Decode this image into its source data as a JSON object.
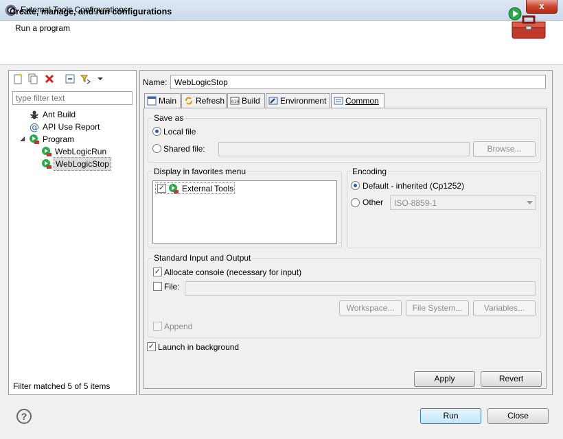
{
  "window": {
    "title": "External Tools Configurations",
    "close_glyph": "x"
  },
  "banner": {
    "title": "Create, manage, and run configurations",
    "subtitle": "Run a program",
    "icon": "toolbox-run-icon"
  },
  "left": {
    "toolbar": [
      "new-config-icon",
      "duplicate-icon",
      "delete-icon",
      "collapse-all-icon",
      "filter-icon",
      "dropdown-arrow-icon"
    ],
    "filter_placeholder": "type filter text",
    "tree": [
      {
        "label": "Ant Build",
        "icon": "ant-icon",
        "level": 1
      },
      {
        "label": "API Use Report",
        "icon": "at-icon",
        "level": 1
      },
      {
        "label": "Program",
        "icon": "program-icon",
        "level": 1,
        "expanded": true
      },
      {
        "label": "WebLogicRun",
        "icon": "program-icon",
        "level": 2
      },
      {
        "label": "WebLogicStop",
        "icon": "program-icon",
        "level": 2,
        "selected": true
      }
    ],
    "status": "Filter matched 5 of 5 items"
  },
  "config": {
    "name_label": "Name:",
    "name_value": "WebLogicStop",
    "tabs": [
      {
        "label": "Main",
        "icon": "main-tab-icon"
      },
      {
        "label": "Refresh",
        "icon": "refresh-icon"
      },
      {
        "label": "Build",
        "icon": "build-icon"
      },
      {
        "label": "Environment",
        "icon": "environment-icon"
      },
      {
        "label": "Common",
        "icon": "common-icon",
        "active": true
      }
    ],
    "save_as": {
      "title": "Save as",
      "local_label": "Local file",
      "shared_label": "Shared file:",
      "browse_label": "Browse..."
    },
    "favorites": {
      "title": "Display in favorites menu",
      "items": [
        {
          "label": "External Tools",
          "checked": true
        }
      ]
    },
    "encoding": {
      "title": "Encoding",
      "default_label": "Default - inherited (Cp1252)",
      "other_label": "Other",
      "other_value": "ISO-8859-1"
    },
    "std_io": {
      "title": "Standard Input and Output",
      "allocate_label": "Allocate console (necessary for input)",
      "file_label": "File:",
      "workspace_label": "Workspace...",
      "filesystem_label": "File System...",
      "variables_label": "Variables...",
      "append_label": "Append"
    },
    "launch_bg_label": "Launch in background",
    "apply_label": "Apply",
    "revert_label": "Revert"
  },
  "footer": {
    "run_label": "Run",
    "close_label": "Close",
    "help_glyph": "?"
  }
}
